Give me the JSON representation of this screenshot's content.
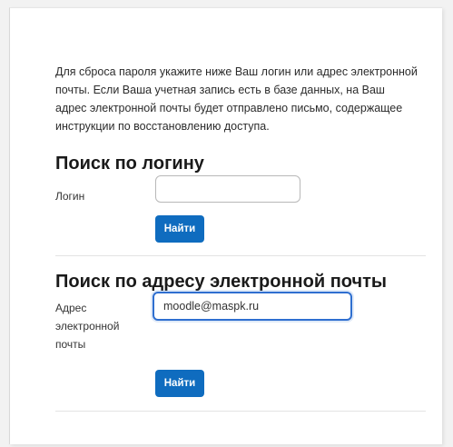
{
  "intro_text": "Для сброса пароля укажите ниже Ваш логин или адрес электронной почты. Если Ваша учетная запись есть в базе данных, на Ваш адрес электронной почты будет отправлено письмо, содержащее инструкции по восстановлению доступа.",
  "login_section": {
    "heading": "Поиск по логину",
    "field_label": "Логин",
    "field_value": "",
    "button_label": "Найти"
  },
  "email_section": {
    "heading": "Поиск по адресу электронной почты",
    "field_label": "Адрес электронной почты",
    "field_value": "moodle@maspk.ru",
    "button_label": "Найти"
  },
  "colors": {
    "primary": "#0f6cbf",
    "focus_border": "#2f6fd0"
  }
}
